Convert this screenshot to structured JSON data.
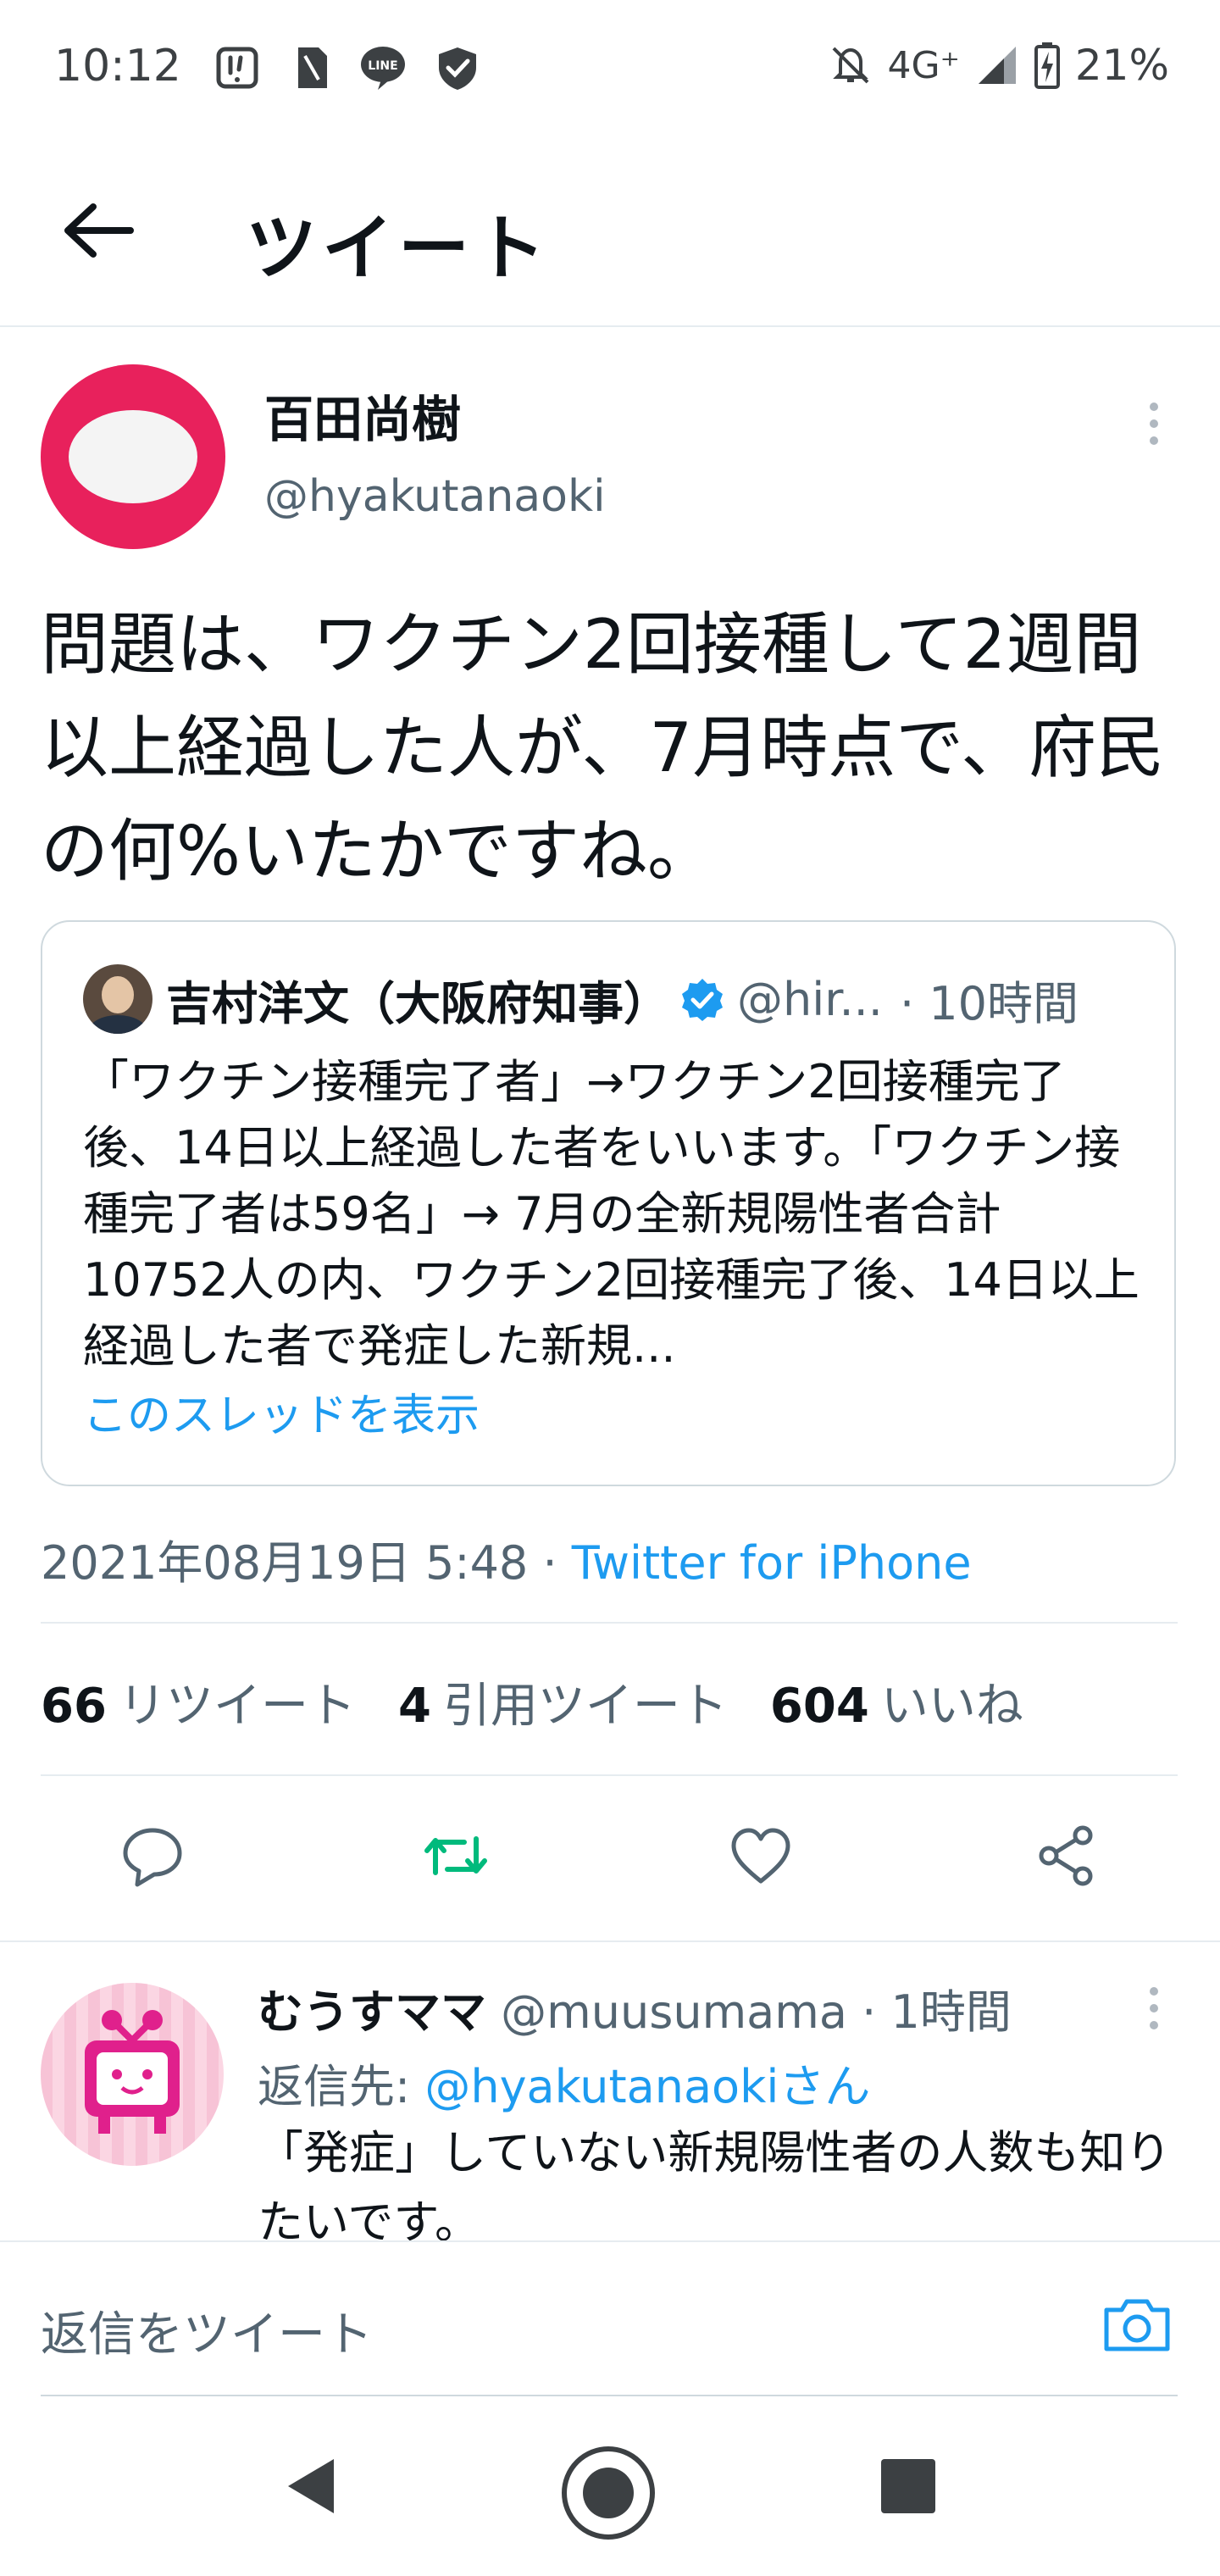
{
  "status_bar": {
    "time": "10:12",
    "network": "4G⁺",
    "battery": "21%",
    "icons": [
      "notification-icon",
      "sim-icon",
      "line-app-icon",
      "shield-check-icon",
      "mute-bell-icon",
      "signal-icon",
      "battery-charging-icon"
    ]
  },
  "header": {
    "title": "ツイート",
    "back_icon": "arrow-left-icon"
  },
  "tweet": {
    "author_name": "百田尚樹",
    "author_handle": "@hyakutanaoki",
    "body": "問題は、ワクチン2回接種して2週間以上経過した人が、7月時点で、府民の何%いたかですね。",
    "quote": {
      "name": "吉村洋文（大阪府知事）",
      "handle": "@hir...",
      "time": "· 10時間",
      "verified": true,
      "text": "「ワクチン接種完了者」→ワクチン2回接種完了後、14日以上経過した者をいいます。「ワクチン接種完了者は59名」→ 7月の全新規陽性者合計10752人の内、ワクチン2回接種完了後、14日以上経過した者で発症した新規...",
      "thread_link": "このスレッドを表示"
    },
    "timestamp": "2021年08月19日 5:48",
    "separator": " · ",
    "client": "Twitter for iPhone",
    "stats": [
      {
        "count": "66",
        "label": "リツイート"
      },
      {
        "count": "4",
        "label": "引用ツイート"
      },
      {
        "count": "604",
        "label": "いいね"
      }
    ],
    "actions": [
      "reply-icon",
      "retweet-icon",
      "like-icon",
      "share-icon"
    ]
  },
  "reply": {
    "author_name": "むうすママ",
    "author_handle": "@muusumama",
    "time": "· 1時間",
    "reply_to_label": "返信先: ",
    "reply_to_handle": "@hyakutanaokiさん",
    "text": "「発症」していない新規陽性者の人数も知りたいです。"
  },
  "compose": {
    "placeholder": "返信をツイート"
  },
  "colors": {
    "accent": "#1d9bf0",
    "retweet_green": "#00ba7c",
    "text_muted": "#536471",
    "avatar_red": "#e8215c"
  }
}
